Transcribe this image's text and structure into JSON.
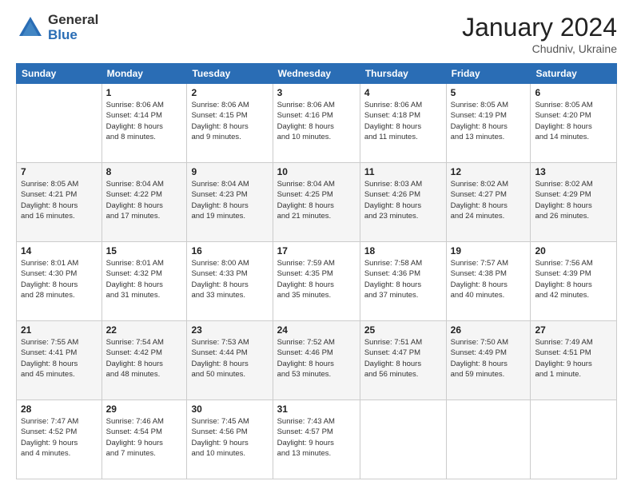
{
  "logo": {
    "general": "General",
    "blue": "Blue"
  },
  "header": {
    "month": "January 2024",
    "location": "Chudniv, Ukraine"
  },
  "weekdays": [
    "Sunday",
    "Monday",
    "Tuesday",
    "Wednesday",
    "Thursday",
    "Friday",
    "Saturday"
  ],
  "weeks": [
    [
      {
        "day": "",
        "info": ""
      },
      {
        "day": "1",
        "info": "Sunrise: 8:06 AM\nSunset: 4:14 PM\nDaylight: 8 hours\nand 8 minutes."
      },
      {
        "day": "2",
        "info": "Sunrise: 8:06 AM\nSunset: 4:15 PM\nDaylight: 8 hours\nand 9 minutes."
      },
      {
        "day": "3",
        "info": "Sunrise: 8:06 AM\nSunset: 4:16 PM\nDaylight: 8 hours\nand 10 minutes."
      },
      {
        "day": "4",
        "info": "Sunrise: 8:06 AM\nSunset: 4:18 PM\nDaylight: 8 hours\nand 11 minutes."
      },
      {
        "day": "5",
        "info": "Sunrise: 8:05 AM\nSunset: 4:19 PM\nDaylight: 8 hours\nand 13 minutes."
      },
      {
        "day": "6",
        "info": "Sunrise: 8:05 AM\nSunset: 4:20 PM\nDaylight: 8 hours\nand 14 minutes."
      }
    ],
    [
      {
        "day": "7",
        "info": "Sunrise: 8:05 AM\nSunset: 4:21 PM\nDaylight: 8 hours\nand 16 minutes."
      },
      {
        "day": "8",
        "info": "Sunrise: 8:04 AM\nSunset: 4:22 PM\nDaylight: 8 hours\nand 17 minutes."
      },
      {
        "day": "9",
        "info": "Sunrise: 8:04 AM\nSunset: 4:23 PM\nDaylight: 8 hours\nand 19 minutes."
      },
      {
        "day": "10",
        "info": "Sunrise: 8:04 AM\nSunset: 4:25 PM\nDaylight: 8 hours\nand 21 minutes."
      },
      {
        "day": "11",
        "info": "Sunrise: 8:03 AM\nSunset: 4:26 PM\nDaylight: 8 hours\nand 23 minutes."
      },
      {
        "day": "12",
        "info": "Sunrise: 8:02 AM\nSunset: 4:27 PM\nDaylight: 8 hours\nand 24 minutes."
      },
      {
        "day": "13",
        "info": "Sunrise: 8:02 AM\nSunset: 4:29 PM\nDaylight: 8 hours\nand 26 minutes."
      }
    ],
    [
      {
        "day": "14",
        "info": "Sunrise: 8:01 AM\nSunset: 4:30 PM\nDaylight: 8 hours\nand 28 minutes."
      },
      {
        "day": "15",
        "info": "Sunrise: 8:01 AM\nSunset: 4:32 PM\nDaylight: 8 hours\nand 31 minutes."
      },
      {
        "day": "16",
        "info": "Sunrise: 8:00 AM\nSunset: 4:33 PM\nDaylight: 8 hours\nand 33 minutes."
      },
      {
        "day": "17",
        "info": "Sunrise: 7:59 AM\nSunset: 4:35 PM\nDaylight: 8 hours\nand 35 minutes."
      },
      {
        "day": "18",
        "info": "Sunrise: 7:58 AM\nSunset: 4:36 PM\nDaylight: 8 hours\nand 37 minutes."
      },
      {
        "day": "19",
        "info": "Sunrise: 7:57 AM\nSunset: 4:38 PM\nDaylight: 8 hours\nand 40 minutes."
      },
      {
        "day": "20",
        "info": "Sunrise: 7:56 AM\nSunset: 4:39 PM\nDaylight: 8 hours\nand 42 minutes."
      }
    ],
    [
      {
        "day": "21",
        "info": "Sunrise: 7:55 AM\nSunset: 4:41 PM\nDaylight: 8 hours\nand 45 minutes."
      },
      {
        "day": "22",
        "info": "Sunrise: 7:54 AM\nSunset: 4:42 PM\nDaylight: 8 hours\nand 48 minutes."
      },
      {
        "day": "23",
        "info": "Sunrise: 7:53 AM\nSunset: 4:44 PM\nDaylight: 8 hours\nand 50 minutes."
      },
      {
        "day": "24",
        "info": "Sunrise: 7:52 AM\nSunset: 4:46 PM\nDaylight: 8 hours\nand 53 minutes."
      },
      {
        "day": "25",
        "info": "Sunrise: 7:51 AM\nSunset: 4:47 PM\nDaylight: 8 hours\nand 56 minutes."
      },
      {
        "day": "26",
        "info": "Sunrise: 7:50 AM\nSunset: 4:49 PM\nDaylight: 8 hours\nand 59 minutes."
      },
      {
        "day": "27",
        "info": "Sunrise: 7:49 AM\nSunset: 4:51 PM\nDaylight: 9 hours\nand 1 minute."
      }
    ],
    [
      {
        "day": "28",
        "info": "Sunrise: 7:47 AM\nSunset: 4:52 PM\nDaylight: 9 hours\nand 4 minutes."
      },
      {
        "day": "29",
        "info": "Sunrise: 7:46 AM\nSunset: 4:54 PM\nDaylight: 9 hours\nand 7 minutes."
      },
      {
        "day": "30",
        "info": "Sunrise: 7:45 AM\nSunset: 4:56 PM\nDaylight: 9 hours\nand 10 minutes."
      },
      {
        "day": "31",
        "info": "Sunrise: 7:43 AM\nSunset: 4:57 PM\nDaylight: 9 hours\nand 13 minutes."
      },
      {
        "day": "",
        "info": ""
      },
      {
        "day": "",
        "info": ""
      },
      {
        "day": "",
        "info": ""
      }
    ]
  ]
}
